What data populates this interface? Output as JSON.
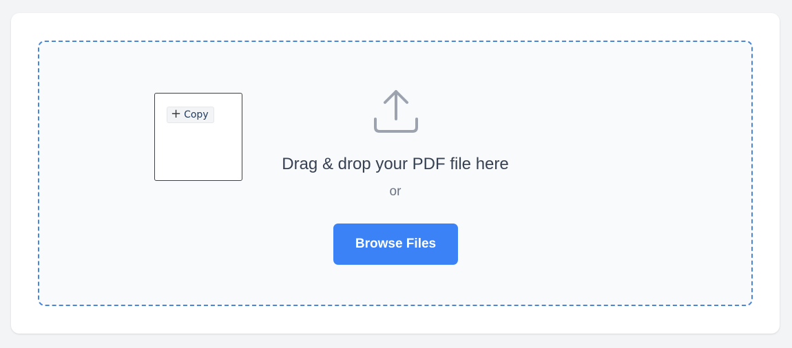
{
  "dropzone": {
    "headline": "Drag & drop your PDF file here",
    "or_text": "or",
    "browse_label": "Browse Files",
    "icon": "upload-icon"
  },
  "preview": {
    "copy_label": "Copy",
    "copy_icon": "plus-icon"
  },
  "colors": {
    "accent": "#3b82f6",
    "dashed_border": "#4a86d8",
    "headline": "#374151",
    "muted": "#6b7280",
    "icon": "#9ca3af"
  }
}
